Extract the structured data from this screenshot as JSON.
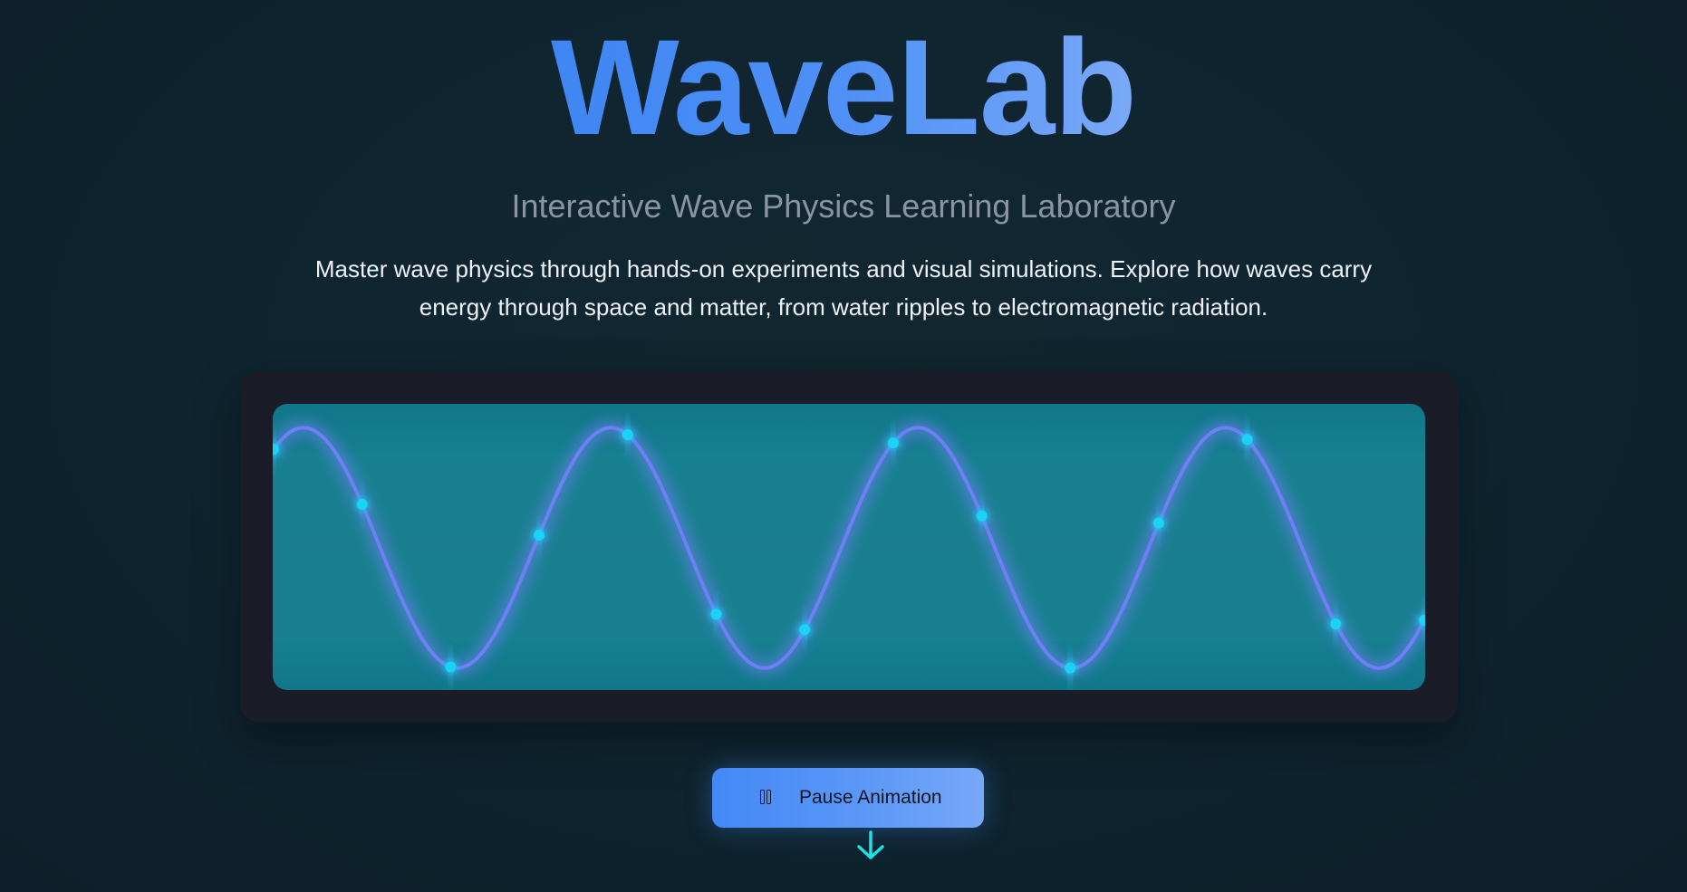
{
  "hero": {
    "title": "WaveLab",
    "subtitle": "Interactive Wave Physics Learning Laboratory",
    "description": "Master wave physics through hands-on experiments and visual simulations. Explore how waves carry energy through space and matter, from water ripples to electromagnetic radiation."
  },
  "simulation": {
    "wave": {
      "cycles_visible": 3.75,
      "amplitude": 0.21,
      "phase": 0.15
    },
    "particle_count": 14,
    "colors": {
      "wave": "#6f7ff5",
      "particle": "#19d4f4",
      "surface": "#167f90"
    }
  },
  "controls": {
    "pause_label": "Pause Animation",
    "pause_icon": "pause-icon",
    "scroll_icon": "arrow-down-icon"
  },
  "colors": {
    "accent": "#4a8ef6",
    "arrow": "#1de0e8",
    "background": "#0f2530"
  }
}
